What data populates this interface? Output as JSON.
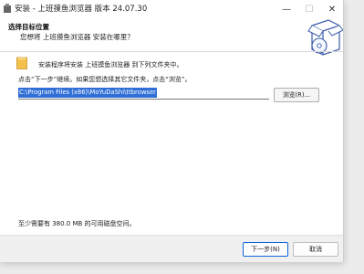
{
  "window": {
    "title": "安装 - 上班摸鱼浏览器 版本 24.07.30",
    "minimize_glyph": "—",
    "maximize_glyph": "☐",
    "close_glyph": "✕"
  },
  "header": {
    "title": "选择目标位置",
    "subtitle": "您想将 上班摸鱼浏览器 安装在哪里？",
    "graphic_icon": "disc-box-icon"
  },
  "body": {
    "info": "安装程序将安装 上班摸鱼浏览器 到下列文件夹中。",
    "hint": "点击“下一步”继续。如果您想选择其它文件夹，点击“浏览”。",
    "path_value": "C:\\Program Files (x86)\\MoYuDaShi\\ttbrowser",
    "browse_label": "浏览(R)...",
    "space_required": "至少需要有 380.0 MB 的可用磁盘空间。"
  },
  "footer": {
    "next_label": "下一步(N)",
    "cancel_label": "取消"
  },
  "colors": {
    "selection": "#2f6fd6",
    "accent_border": "#0a64d8",
    "folder": "#f4c04e"
  }
}
